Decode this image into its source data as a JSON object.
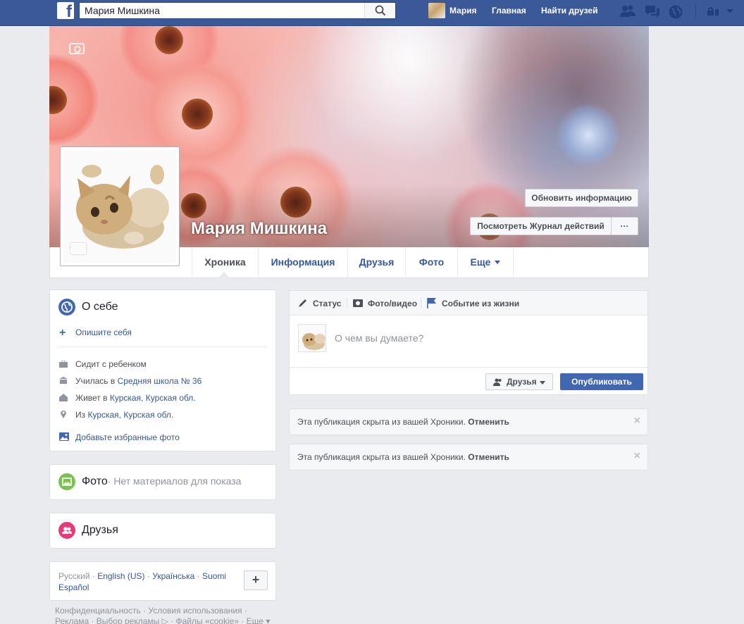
{
  "topbar": {
    "search_value": "Мария Мишкина",
    "user_name": "Мария",
    "home": "Главная",
    "find_friends": "Найти друзей"
  },
  "profile": {
    "name": "Мария Мишкина",
    "update_info": "Обновить информацию",
    "activity_log": "Посмотреть Журнал действий",
    "more_dots": "···"
  },
  "tabs": [
    {
      "label": "Хроника"
    },
    {
      "label": "Информация"
    },
    {
      "label": "Друзья"
    },
    {
      "label": "Фото"
    },
    {
      "label": "Еще"
    }
  ],
  "about": {
    "title": "О себе",
    "describe": "Опишите себя",
    "items": [
      {
        "text": "Сидит с ребенком",
        "link": ""
      },
      {
        "text": "Училась в ",
        "link": "Средняя школа № 36"
      },
      {
        "text": "Живет в ",
        "link": "Курская, Курская обл."
      },
      {
        "text": "Из ",
        "link": "Курская, Курская обл."
      }
    ],
    "add_photos": "Добавьте избранные фото"
  },
  "photos": {
    "title": "Фото",
    "empty": "· Нет материалов для показа"
  },
  "friends": {
    "title": "Друзья"
  },
  "languages": {
    "current": "Русский",
    "others": [
      "English (US)",
      "Українська",
      "Suomi",
      "Español"
    ]
  },
  "footer": {
    "line1": "Конфиденциальность · Условия использования ·",
    "line2": "Реклама · Выбор рекламы ▷ · Файлы «cookie» · Еще ▾"
  },
  "composer": {
    "status": "Статус",
    "photo_video": "Фото/видео",
    "life_event": "Событие из жизни",
    "placeholder": "О чем вы думаете?",
    "audience": "Друзья",
    "publish": "Опубликовать"
  },
  "hidden_posts": [
    {
      "text": "Эта публикация скрыта из вашей Хроники.",
      "action": "Отменить"
    },
    {
      "text": "Эта публикация скрыта из вашей Хроники.",
      "action": "Отменить"
    }
  ],
  "colors": {
    "brand": "#3b5998",
    "link": "#365899",
    "publish": "#4267b2",
    "background": "#e9ebee"
  },
  "icons": [
    "facebook-logo-icon",
    "search-icon",
    "friend-requests-icon",
    "messages-icon",
    "notifications-globe-icon",
    "privacy-lock-icon",
    "chevron-down-icon",
    "camera-icon",
    "globe-icon",
    "plus-icon",
    "briefcase-icon",
    "school-icon",
    "home-icon",
    "location-pin-icon",
    "photo-icon",
    "friends-icon",
    "pencil-icon",
    "flag-icon",
    "close-icon"
  ]
}
